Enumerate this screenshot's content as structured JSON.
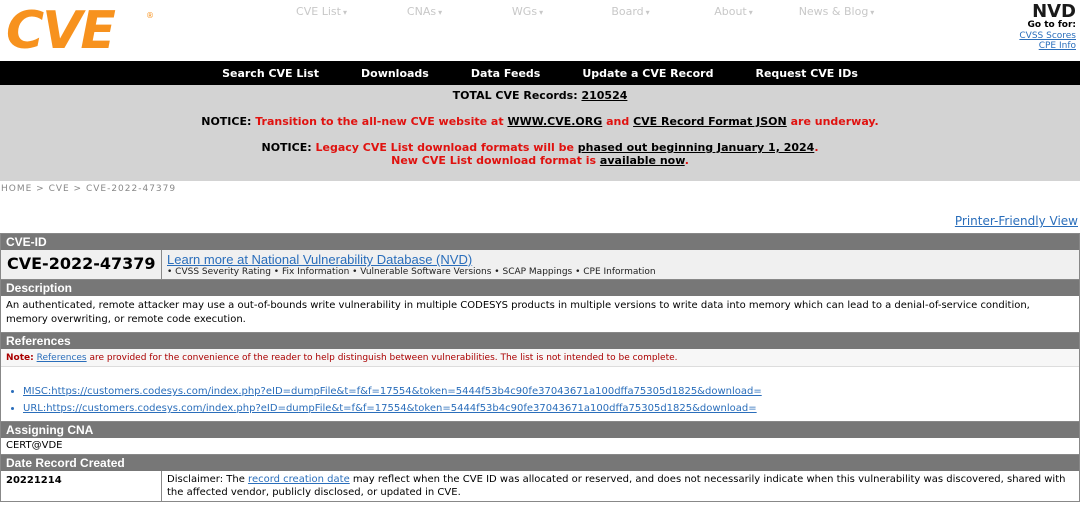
{
  "header": {
    "logo": "CVE",
    "logo_reg": "®",
    "top_nav": [
      "CVE List",
      "CNAs",
      "WGs",
      "Board",
      "About",
      "News & Blog"
    ],
    "nvd": {
      "logo": "NVD",
      "goto": "Go to for:",
      "links": [
        "CVSS Scores",
        "CPE Info"
      ]
    }
  },
  "black_nav": [
    "Search CVE List",
    "Downloads",
    "Data Feeds",
    "Update a CVE Record",
    "Request CVE IDs"
  ],
  "notice": {
    "total_label": "TOTAL CVE Records:",
    "total_value": "210524",
    "n1_label": "NOTICE:",
    "n1_red_a": "Transition to the all-new CVE website at",
    "n1_link_a": "WWW.CVE.ORG",
    "n1_red_b": "and",
    "n1_link_b": "CVE Record Format JSON",
    "n1_red_c": "are underway.",
    "n2_label": "NOTICE:",
    "n2_red_a": "Legacy CVE List download formats will be",
    "n2_link_a": "phased out beginning January 1, 2024",
    "n2_red_b": ".",
    "n2_red_c": "New CVE List download format is",
    "n2_link_b": "available now",
    "n2_red_d": "."
  },
  "breadcrumb": "HOME > CVE > CVE-2022-47379",
  "printer_friendly": "Printer-Friendly View",
  "record": {
    "id_header": "CVE-ID",
    "cve_id": "CVE-2022-47379",
    "nvd_link": "Learn more at National Vulnerability Database (NVD)",
    "nvd_bullets": "• CVSS Severity Rating • Fix Information • Vulnerable Software Versions • SCAP Mappings • CPE Information",
    "desc_header": "Description",
    "description": "An authenticated, remote attacker may use a out-of-bounds write vulnerability in multiple CODESYS products in multiple versions to write data into memory which can lead to a denial-of-service condition, memory overwriting, or remote code execution.",
    "refs_header": "References",
    "ref_note_label": "Note:",
    "ref_note_link": "References",
    "ref_note_text": "are provided for the convenience of the reader to help distinguish between vulnerabilities. The list is not intended to be complete.",
    "references": [
      "MISC:https://customers.codesys.com/index.php?eID=dumpFile&t=f&f=17554&token=5444f53b4c90fe37043671a100dffa75305d1825&download=",
      "URL:https://customers.codesys.com/index.php?eID=dumpFile&t=f&f=17554&token=5444f53b4c90fe37043671a100dffa75305d1825&download="
    ],
    "cna_header": "Assigning CNA",
    "cna": "CERT@VDE",
    "date_header": "Date Record Created",
    "date": "20221214",
    "disclaimer_a": "Disclaimer: The",
    "disclaimer_link": "record creation date",
    "disclaimer_b": "may reflect when the CVE ID was allocated or reserved, and does not necessarily indicate when this vulnerability was discovered, shared with the affected vendor, publicly disclosed, or updated in CVE."
  },
  "colors": {
    "logo_orange": "#f7921e",
    "notice_red": "#e0120f",
    "link_blue": "#2a6ebb",
    "section_gray": "#777777"
  }
}
